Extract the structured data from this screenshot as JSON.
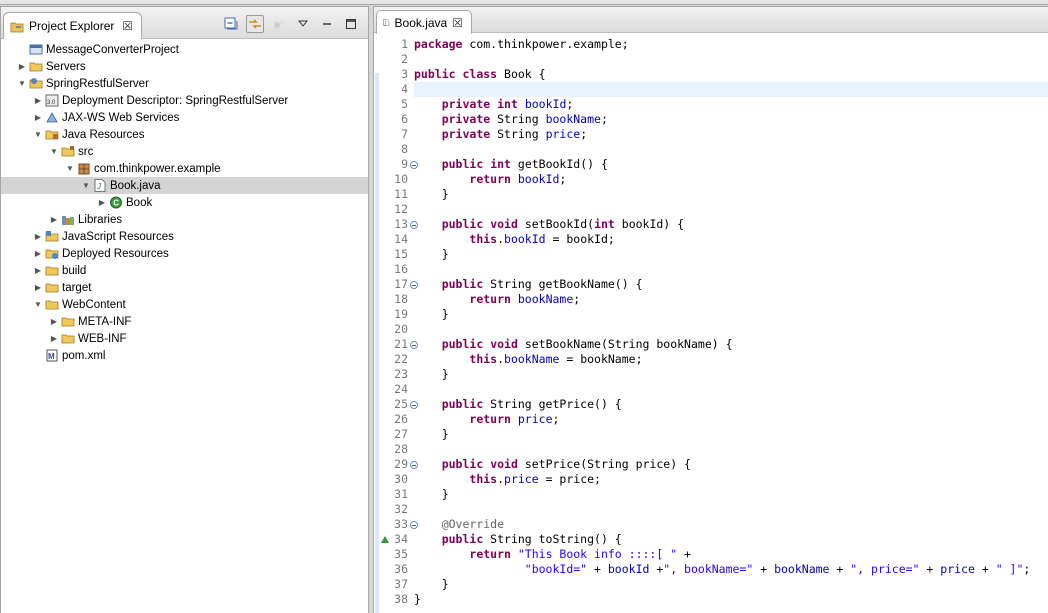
{
  "explorer": {
    "tab_title": "Project Explorer",
    "tree": [
      {
        "label": "MessageConverterProject",
        "indent": 0,
        "twisty": "",
        "icon": "project-icon"
      },
      {
        "label": "Servers",
        "indent": 0,
        "twisty": "collapsed",
        "icon": "folder-icon"
      },
      {
        "label": "SpringRestfulServer",
        "indent": 0,
        "twisty": "expanded",
        "icon": "web-project-icon"
      },
      {
        "label": "Deployment Descriptor: SpringRestfulServer",
        "indent": 1,
        "twisty": "collapsed",
        "icon": "deployment-descriptor-icon"
      },
      {
        "label": "JAX-WS Web Services",
        "indent": 1,
        "twisty": "collapsed",
        "icon": "web-services-icon"
      },
      {
        "label": "Java Resources",
        "indent": 1,
        "twisty": "expanded",
        "icon": "java-resources-icon"
      },
      {
        "label": "src",
        "indent": 2,
        "twisty": "expanded",
        "icon": "source-folder-icon"
      },
      {
        "label": "com.thinkpower.example",
        "indent": 3,
        "twisty": "expanded",
        "icon": "package-icon"
      },
      {
        "label": "Book.java",
        "indent": 4,
        "twisty": "expanded",
        "icon": "java-file-icon",
        "selected": true
      },
      {
        "label": "Book",
        "indent": 5,
        "twisty": "collapsed",
        "icon": "class-icon"
      },
      {
        "label": "Libraries",
        "indent": 2,
        "twisty": "collapsed",
        "icon": "libraries-icon"
      },
      {
        "label": "JavaScript Resources",
        "indent": 1,
        "twisty": "collapsed",
        "icon": "javascript-resources-icon"
      },
      {
        "label": "Deployed Resources",
        "indent": 1,
        "twisty": "collapsed",
        "icon": "deployed-resources-icon"
      },
      {
        "label": "build",
        "indent": 1,
        "twisty": "collapsed",
        "icon": "folder-icon"
      },
      {
        "label": "target",
        "indent": 1,
        "twisty": "collapsed",
        "icon": "folder-icon"
      },
      {
        "label": "WebContent",
        "indent": 1,
        "twisty": "expanded",
        "icon": "folder-icon"
      },
      {
        "label": "META-INF",
        "indent": 2,
        "twisty": "collapsed",
        "icon": "folder-icon"
      },
      {
        "label": "WEB-INF",
        "indent": 2,
        "twisty": "collapsed",
        "icon": "folder-icon"
      },
      {
        "label": "pom.xml",
        "indent": 1,
        "twisty": "",
        "icon": "maven-file-icon"
      }
    ]
  },
  "editor": {
    "tab_title": "Book.java",
    "current_line": 4,
    "fold_lines": [
      9,
      13,
      17,
      21,
      25,
      29,
      33
    ],
    "override_line": 34,
    "lines": [
      [
        {
          "t": "package",
          "c": "kw"
        },
        {
          "t": " com.thinkpower.example;"
        }
      ],
      [],
      [
        {
          "t": "public",
          "c": "kw"
        },
        {
          "t": " "
        },
        {
          "t": "class",
          "c": "kw"
        },
        {
          "t": " Book {"
        }
      ],
      [],
      [
        {
          "t": "    "
        },
        {
          "t": "private",
          "c": "kw"
        },
        {
          "t": " "
        },
        {
          "t": "int",
          "c": "kw"
        },
        {
          "t": " "
        },
        {
          "t": "bookId",
          "c": "fld"
        },
        {
          "t": ";"
        }
      ],
      [
        {
          "t": "    "
        },
        {
          "t": "private",
          "c": "kw"
        },
        {
          "t": " String "
        },
        {
          "t": "bookName",
          "c": "fld"
        },
        {
          "t": ";"
        }
      ],
      [
        {
          "t": "    "
        },
        {
          "t": "private",
          "c": "kw"
        },
        {
          "t": " String "
        },
        {
          "t": "price",
          "c": "fld"
        },
        {
          "t": ";"
        }
      ],
      [],
      [
        {
          "t": "    "
        },
        {
          "t": "public",
          "c": "kw"
        },
        {
          "t": " "
        },
        {
          "t": "int",
          "c": "kw"
        },
        {
          "t": " getBookId() {"
        }
      ],
      [
        {
          "t": "        "
        },
        {
          "t": "return",
          "c": "kw"
        },
        {
          "t": " "
        },
        {
          "t": "bookId",
          "c": "fld"
        },
        {
          "t": ";"
        }
      ],
      [
        {
          "t": "    }"
        }
      ],
      [],
      [
        {
          "t": "    "
        },
        {
          "t": "public",
          "c": "kw"
        },
        {
          "t": " "
        },
        {
          "t": "void",
          "c": "kw"
        },
        {
          "t": " setBookId("
        },
        {
          "t": "int",
          "c": "kw"
        },
        {
          "t": " bookId) {"
        }
      ],
      [
        {
          "t": "        "
        },
        {
          "t": "this",
          "c": "kw"
        },
        {
          "t": "."
        },
        {
          "t": "bookId",
          "c": "fld"
        },
        {
          "t": " = bookId;"
        }
      ],
      [
        {
          "t": "    }"
        }
      ],
      [],
      [
        {
          "t": "    "
        },
        {
          "t": "public",
          "c": "kw"
        },
        {
          "t": " String getBookName() {"
        }
      ],
      [
        {
          "t": "        "
        },
        {
          "t": "return",
          "c": "kw"
        },
        {
          "t": " "
        },
        {
          "t": "bookName",
          "c": "fld"
        },
        {
          "t": ";"
        }
      ],
      [
        {
          "t": "    }"
        }
      ],
      [],
      [
        {
          "t": "    "
        },
        {
          "t": "public",
          "c": "kw"
        },
        {
          "t": " "
        },
        {
          "t": "void",
          "c": "kw"
        },
        {
          "t": " setBookName(String bookName) {"
        }
      ],
      [
        {
          "t": "        "
        },
        {
          "t": "this",
          "c": "kw"
        },
        {
          "t": "."
        },
        {
          "t": "bookName",
          "c": "fld"
        },
        {
          "t": " = bookName;"
        }
      ],
      [
        {
          "t": "    }"
        }
      ],
      [],
      [
        {
          "t": "    "
        },
        {
          "t": "public",
          "c": "kw"
        },
        {
          "t": " String getPrice() {"
        }
      ],
      [
        {
          "t": "        "
        },
        {
          "t": "return",
          "c": "kw"
        },
        {
          "t": " "
        },
        {
          "t": "price",
          "c": "fld"
        },
        {
          "t": ";"
        }
      ],
      [
        {
          "t": "    }"
        }
      ],
      [],
      [
        {
          "t": "    "
        },
        {
          "t": "public",
          "c": "kw"
        },
        {
          "t": " "
        },
        {
          "t": "void",
          "c": "kw"
        },
        {
          "t": " setPrice(String price) {"
        }
      ],
      [
        {
          "t": "        "
        },
        {
          "t": "this",
          "c": "kw"
        },
        {
          "t": "."
        },
        {
          "t": "price",
          "c": "fld"
        },
        {
          "t": " = price;"
        }
      ],
      [
        {
          "t": "    }"
        }
      ],
      [],
      [
        {
          "t": "    "
        },
        {
          "t": "@Override",
          "c": "ann"
        }
      ],
      [
        {
          "t": "    "
        },
        {
          "t": "public",
          "c": "kw"
        },
        {
          "t": " String toString() {"
        }
      ],
      [
        {
          "t": "        "
        },
        {
          "t": "return",
          "c": "kw"
        },
        {
          "t": " "
        },
        {
          "t": "\"This Book info ::::[ \"",
          "c": "str"
        },
        {
          "t": " +"
        }
      ],
      [
        {
          "t": "                "
        },
        {
          "t": "\"bookId=\"",
          "c": "str"
        },
        {
          "t": " + "
        },
        {
          "t": "bookId",
          "c": "fld"
        },
        {
          "t": " +"
        },
        {
          "t": "\", bookName=\"",
          "c": "str"
        },
        {
          "t": " + "
        },
        {
          "t": "bookName",
          "c": "fld"
        },
        {
          "t": " + "
        },
        {
          "t": "\", price=\"",
          "c": "str"
        },
        {
          "t": " + "
        },
        {
          "t": "price",
          "c": "fld"
        },
        {
          "t": " + "
        },
        {
          "t": "\" ]\"",
          "c": "str"
        },
        {
          "t": ";"
        }
      ],
      [
        {
          "t": "    }"
        }
      ],
      [
        {
          "t": "}"
        }
      ]
    ]
  },
  "colors": {
    "keyword": "#7f0055",
    "field": "#0000c0",
    "string": "#2a00ff",
    "annotation": "#646464",
    "current_line": "#e8f2fe",
    "selection": "#d4d4d4"
  }
}
